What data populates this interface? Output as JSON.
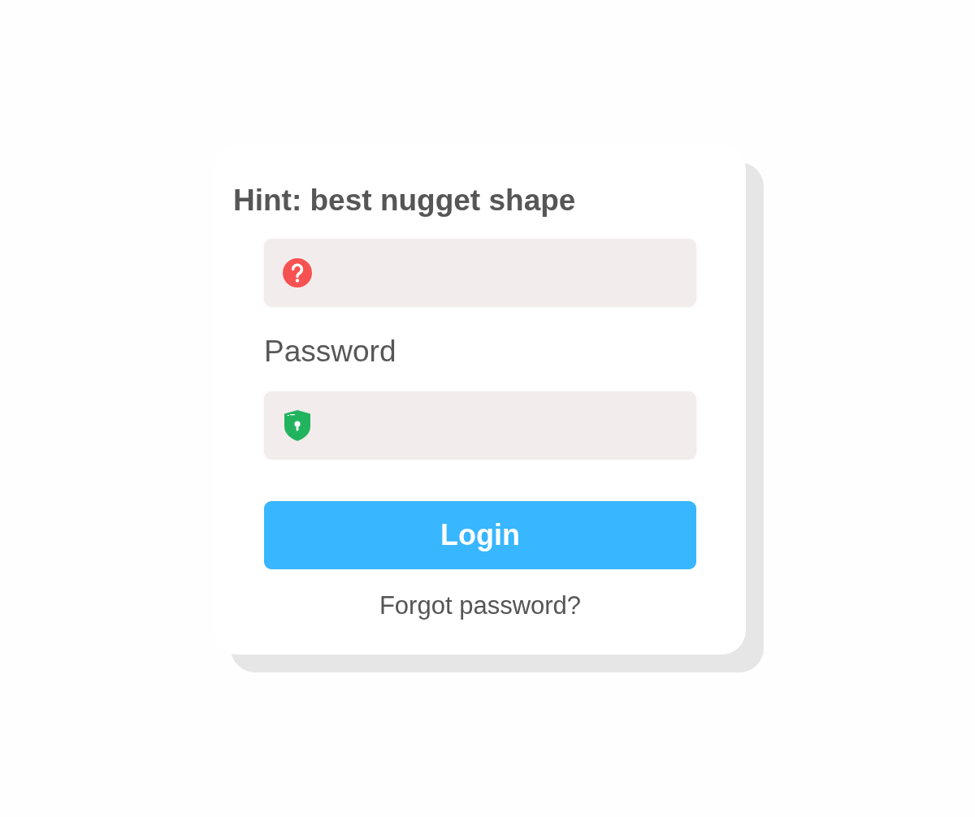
{
  "heading": "Hint: best nugget shape",
  "fields": [
    {
      "kind": "answer"
    },
    {
      "kind": "password",
      "label": "Password"
    }
  ],
  "login_button": {
    "label": "Login"
  },
  "forgot_link": {
    "label": "Forgot password?"
  }
}
